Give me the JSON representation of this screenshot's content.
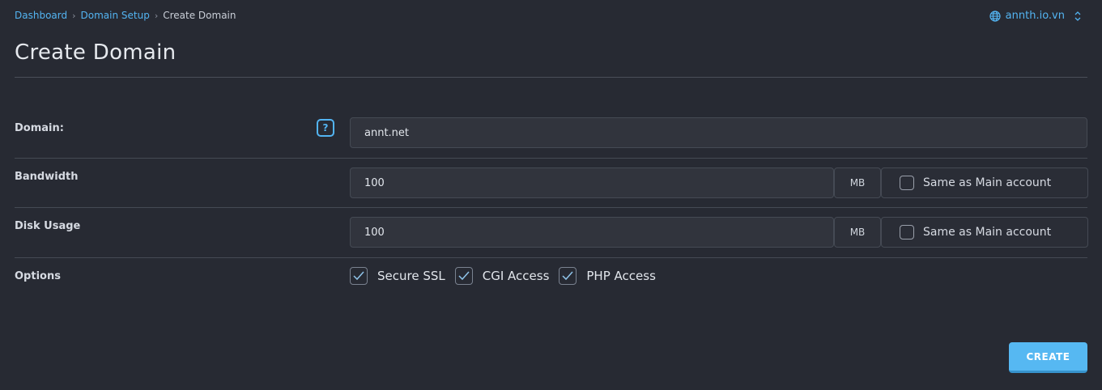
{
  "breadcrumb": {
    "items": [
      "Dashboard",
      "Domain Setup"
    ],
    "current": "Create Domain"
  },
  "account": {
    "name": "annth.io.vn",
    "icon": "globe-icon"
  },
  "page": {
    "title": "Create Domain"
  },
  "form": {
    "domain": {
      "label": "Domain:",
      "value": "annt.net",
      "help": "?"
    },
    "bandwidth": {
      "label": "Bandwidth",
      "value": "100",
      "unit": "MB",
      "same_label": "Same as Main account",
      "same_checked": false
    },
    "disk": {
      "label": "Disk Usage",
      "value": "100",
      "unit": "MB",
      "same_label": "Same as Main account",
      "same_checked": false
    },
    "options": {
      "label": "Options",
      "items": [
        {
          "label": "Secure SSL",
          "checked": true
        },
        {
          "label": "CGI Access",
          "checked": true
        },
        {
          "label": "PHP Access",
          "checked": true
        }
      ]
    }
  },
  "actions": {
    "create_label": "CREATE"
  },
  "colors": {
    "accent": "#53b4f2",
    "background": "#272a33"
  }
}
